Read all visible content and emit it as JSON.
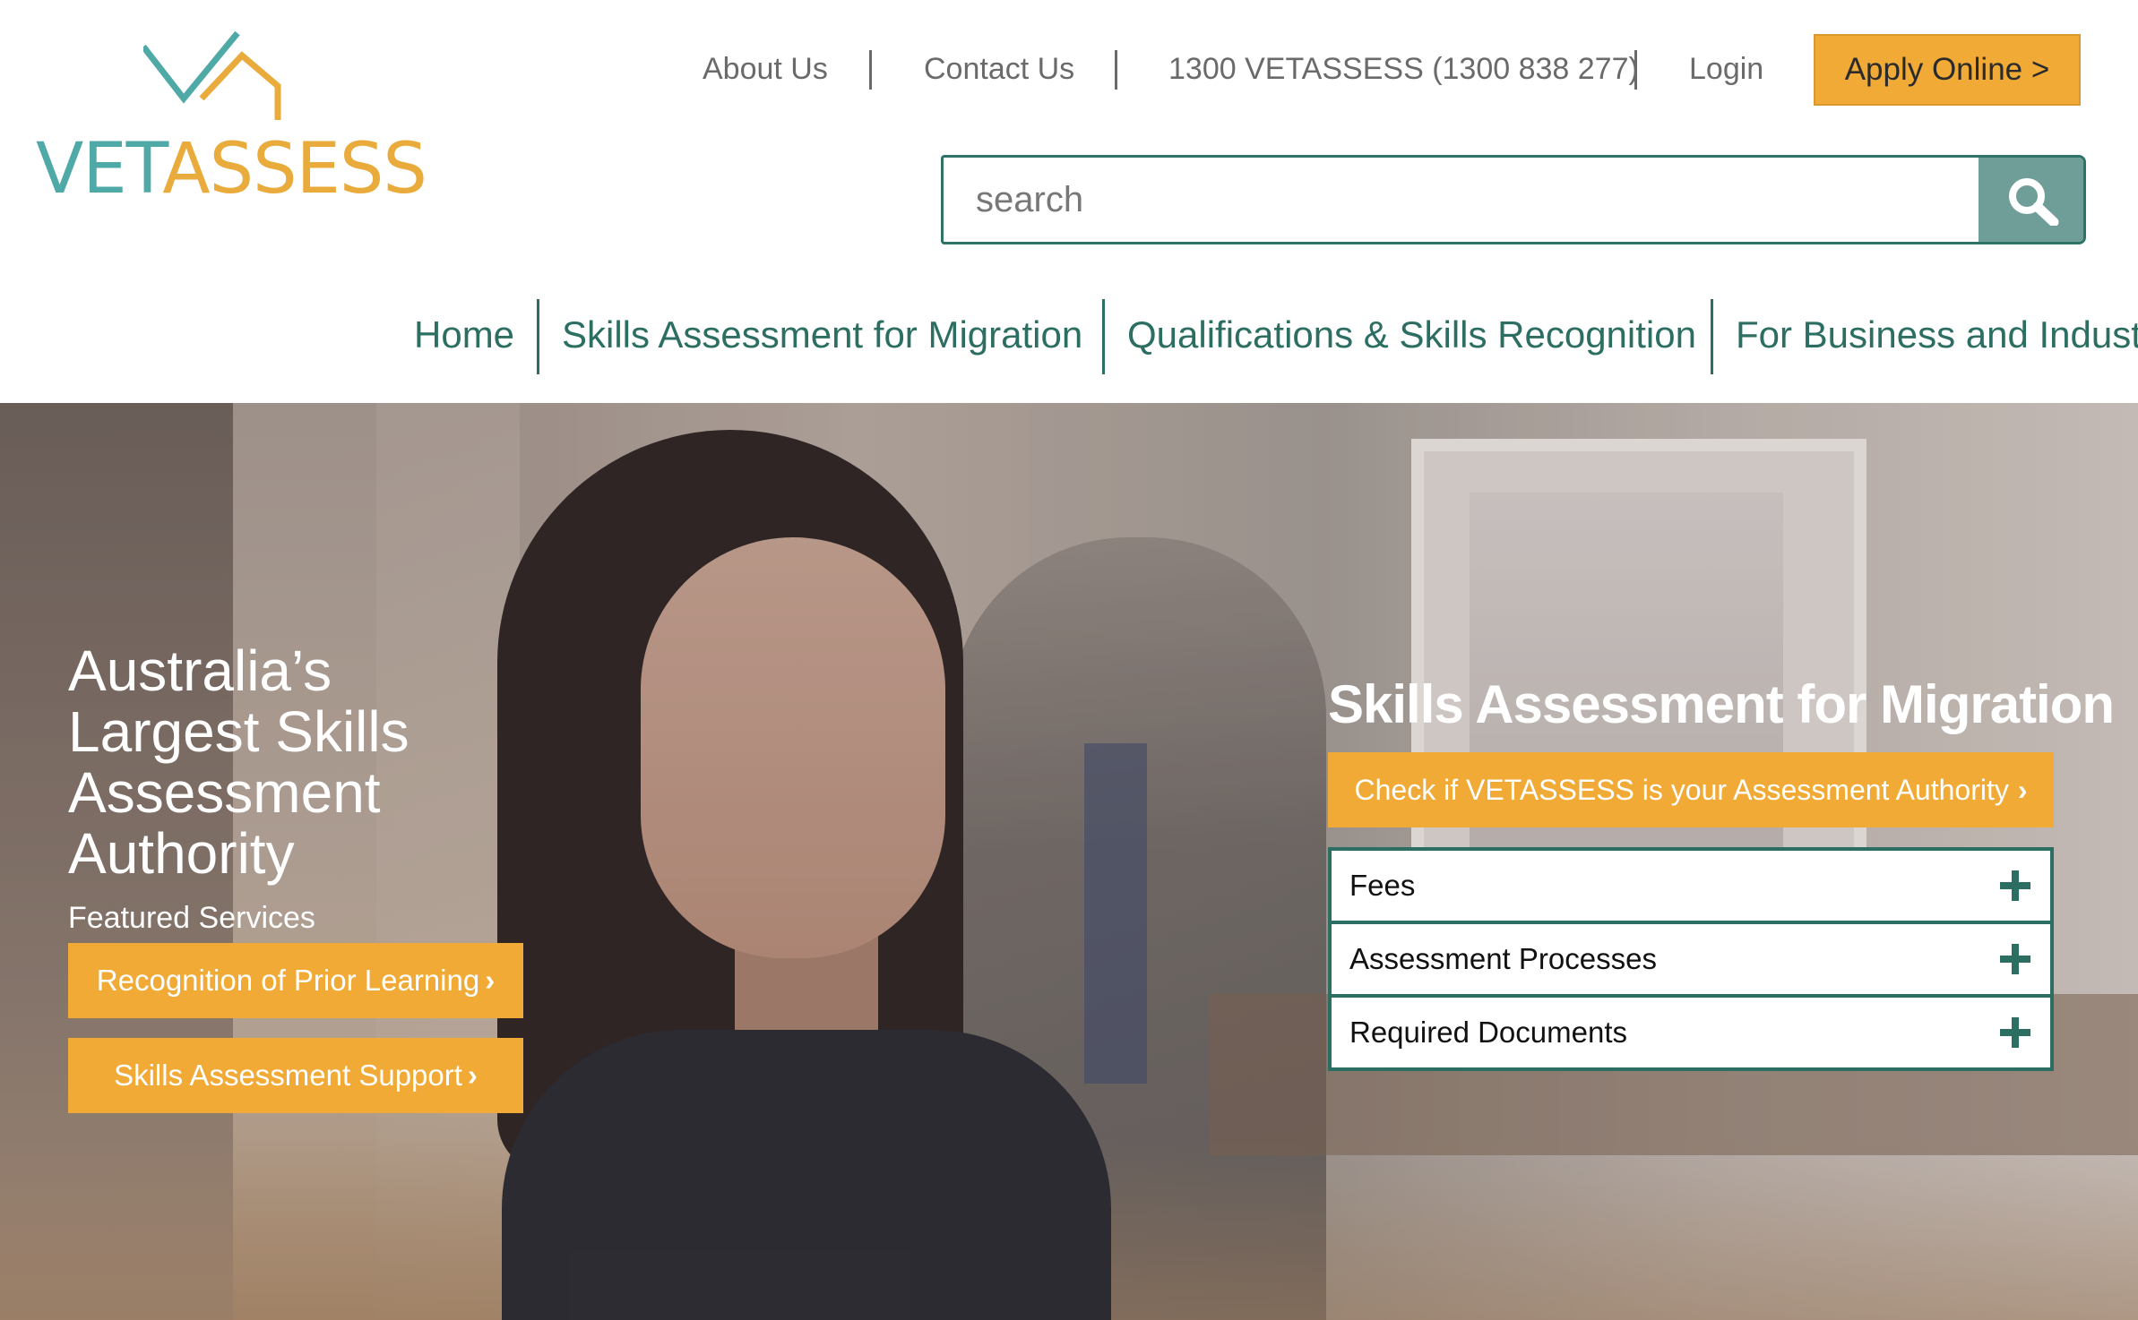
{
  "brand": {
    "logo_text_a": "VET",
    "logo_text_b": "ASSESS",
    "teal": "#4fa9a6",
    "gold": "#e9ab3c",
    "nav_green": "#2c6e62",
    "accent_orange": "#f0aa35"
  },
  "topnav": {
    "about": "About Us",
    "contact": "Contact Us",
    "phone": "1300 VETASSESS (1300 838 277)",
    "login": "Login",
    "apply": "Apply Online >"
  },
  "search": {
    "placeholder": "search",
    "icon": "search-icon"
  },
  "mainnav": {
    "items": [
      "Home",
      "Skills Assessment for Migration",
      "Qualifications & Skills Recognition",
      "For Business and Indust"
    ]
  },
  "hero": {
    "title": "Australia’s Largest Skills Assessment Authority",
    "featured_label": "Featured Services",
    "featured_buttons": [
      "Recognition of Prior Learning",
      "Skills Assessment Support"
    ],
    "panel_title": "Skills Assessment for Migration",
    "check_button": "Check if VETASSESS is your Assessment Authority",
    "accordion": [
      "Fees",
      "Assessment Processes",
      "Required Documents"
    ]
  }
}
